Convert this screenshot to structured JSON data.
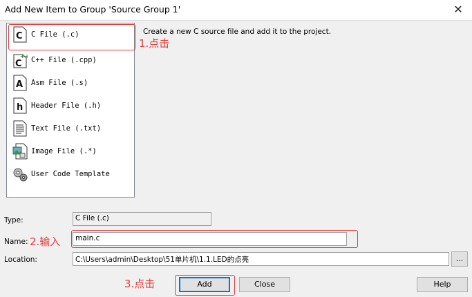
{
  "window": {
    "title": "Add New Item to Group 'Source Group 1'",
    "close_glyph": "✕"
  },
  "file_types": [
    {
      "label": "C File (.c)",
      "icon": "c-file-icon",
      "glyph": "C"
    },
    {
      "label": "C++ File (.cpp)",
      "icon": "cpp-file-icon",
      "glyph": "C"
    },
    {
      "label": "Asm File (.s)",
      "icon": "asm-file-icon",
      "glyph": "A"
    },
    {
      "label": "Header File (.h)",
      "icon": "header-file-icon",
      "glyph": "h"
    },
    {
      "label": "Text File (.txt)",
      "icon": "text-file-icon",
      "glyph": ""
    },
    {
      "label": "Image File (.*)",
      "icon": "image-file-icon",
      "glyph": ""
    },
    {
      "label": "User Code Template",
      "icon": "user-code-template-icon",
      "glyph": ""
    }
  ],
  "description": "Create a new C source file and add it to the project.",
  "form": {
    "type_label": "Type:",
    "type_value": "C File (.c)",
    "name_label": "Name:",
    "name_value": "main.c",
    "location_label": "Location:",
    "location_value": "C:\\Users\\admin\\Desktop\\51单片机\\1.1.LED的点亮",
    "browse_label": "..."
  },
  "buttons": {
    "add": "Add",
    "close": "Close",
    "help": "Help"
  },
  "annotations": {
    "step1": "1.点击",
    "step2": "2.输入",
    "step3": "3.点击"
  },
  "colors": {
    "annotation": "#e03b3b",
    "listbox_bg": "#ffffff",
    "dialog_bg": "#f0f0f0"
  }
}
